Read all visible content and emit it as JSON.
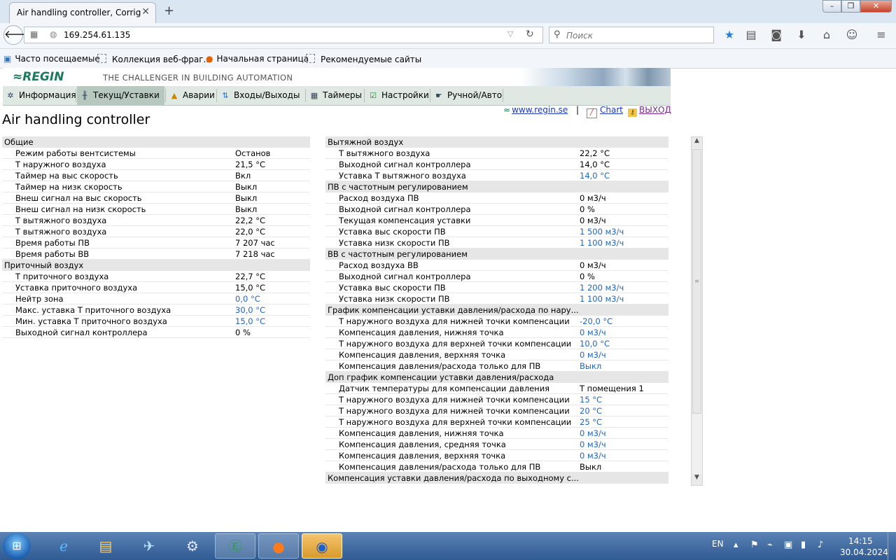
{
  "browser": {
    "tab_title": "Air handling controller, Corrigo E",
    "tab_close": "✕",
    "new_tab": "+",
    "url": "169.254.61.135",
    "search_placeholder": "Поиск",
    "bookmarks": [
      "Часто посещаемые",
      "Коллекция веб-фраг...",
      "Начальная страница",
      "Рекомендуемые сайты"
    ]
  },
  "app": {
    "logo": "≈REGIN",
    "tagline": "THE CHALLENGER IN BUILDING AUTOMATION",
    "menu": [
      "Информация",
      "Текущ/Уставки",
      "Аварии",
      "Входы/Выходы",
      "Таймеры",
      "Настройки",
      "Ручной/Авто"
    ],
    "active_menu": "Текущ/Уставки",
    "page_title": "Air handling controller",
    "links": {
      "site": "www.regin.se",
      "sep": "|",
      "chart": "Chart",
      "exit": "ВЫХОД"
    }
  },
  "left": [
    {
      "title": "Общие",
      "rows": [
        {
          "label": "Режим работы вентсистемы",
          "value": "Останов",
          "editable": false
        },
        {
          "label": "Т наружного воздуха",
          "value": "21,5 °C",
          "editable": false
        },
        {
          "label": "Таймер на выс скорость",
          "value": "Вкл",
          "editable": false
        },
        {
          "label": "Таймер на низк скорость",
          "value": "Выкл",
          "editable": false
        },
        {
          "label": "Внеш сигнал на выс скорость",
          "value": "Выкл",
          "editable": false
        },
        {
          "label": "Внеш сигнал на низк скорость",
          "value": "Выкл",
          "editable": false
        },
        {
          "label": "Т вытяжного воздуха",
          "value": "22,2 °C",
          "editable": false
        },
        {
          "label": "Т вытяжного воздуха",
          "value": "22,0 °C",
          "editable": false
        },
        {
          "label": "Время работы ПВ",
          "value": "7 207 час",
          "editable": false
        },
        {
          "label": "Время работы ВВ",
          "value": "7 218 час",
          "editable": false
        }
      ]
    },
    {
      "title": "Приточный воздух",
      "rows": [
        {
          "label": "Т приточного воздуха",
          "value": "22,7 °C",
          "editable": false
        },
        {
          "label": "Уставка приточного воздуха",
          "value": "15,0 °C",
          "editable": false
        },
        {
          "label": "Нейтр зона",
          "value": "0,0 °C",
          "editable": true
        },
        {
          "label": "Макс. уставка Т приточного воздуха",
          "value": "30,0 °C",
          "editable": true
        },
        {
          "label": "Мин. уставка Т приточного воздуха",
          "value": "15,0 °C",
          "editable": true
        },
        {
          "label": "Выходной сигнал контроллера",
          "value": "0 %",
          "editable": false
        }
      ]
    }
  ],
  "right": [
    {
      "title": "Вытяжной воздух",
      "rows": [
        {
          "label": "Т вытяжного воздуха",
          "value": "22,2 °C",
          "editable": false
        },
        {
          "label": "Выходной сигнал контроллера",
          "value": "14,0 °C",
          "editable": false
        },
        {
          "label": "Уставка Т вытяжного воздуха",
          "value": "14,0 °C",
          "editable": true
        }
      ]
    },
    {
      "title": "ПВ с частотным регулированием",
      "rows": [
        {
          "label": "Расход воздуха ПВ",
          "value": "0 м3/ч",
          "editable": false
        },
        {
          "label": "Выходной сигнал контроллера",
          "value": "0 %",
          "editable": false
        },
        {
          "label": "Текущая компенсация уставки",
          "value": "0 м3/ч",
          "editable": false
        },
        {
          "label": "Уставка выс скорости ПВ",
          "value": "1 500 м3/ч",
          "editable": true
        },
        {
          "label": "Уставка низк скорости ПВ",
          "value": "1 100 м3/ч",
          "editable": true
        }
      ]
    },
    {
      "title": "ВВ с частотным регулированием",
      "rows": [
        {
          "label": "Расход воздуха ВВ",
          "value": "0 м3/ч",
          "editable": false
        },
        {
          "label": "Выходной сигнал контроллера",
          "value": "0 %",
          "editable": false
        },
        {
          "label": "Уставка выс скорости ПВ",
          "value": "1 200 м3/ч",
          "editable": true
        },
        {
          "label": "Уставка низк скорости ПВ",
          "value": "1 100 м3/ч",
          "editable": true
        }
      ]
    },
    {
      "title": "График компенсации уставки давления/расхода по нару...",
      "rows": [
        {
          "label": "Т наружного воздуха для нижней точки компенсации",
          "value": "-20,0 °C",
          "editable": true
        },
        {
          "label": "Компенсация давления, нижняя точка",
          "value": "0 м3/ч",
          "editable": true
        },
        {
          "label": "Т наружного воздуха для верхней точки компенсации",
          "value": "10,0 °C",
          "editable": true
        },
        {
          "label": "Компенсация давления, верхняя точка",
          "value": "0 м3/ч",
          "editable": true
        },
        {
          "label": "Компенсация давления/расхода только для ПВ",
          "value": "Выкл",
          "editable": true
        }
      ]
    },
    {
      "title": "Доп график компенсации уставки давления/расхода",
      "rows": [
        {
          "label": "Датчик температуры для компенсации давления",
          "value": "Т помещения 1",
          "editable": false
        },
        {
          "label": "Т наружного воздуха для нижней точки компенсации",
          "value": "15 °C",
          "editable": true
        },
        {
          "label": "Т наружного воздуха для нижней точки компенсации",
          "value": "20 °C",
          "editable": true
        },
        {
          "label": "Т наружного воздуха для верхней точки компенсации",
          "value": "25 °C",
          "editable": true
        },
        {
          "label": "Компенсация давления, нижняя точка",
          "value": "0 м3/ч",
          "editable": true
        },
        {
          "label": "Компенсация давления, средняя точка",
          "value": "0 м3/ч",
          "editable": true
        },
        {
          "label": "Компенсация давления, верхняя точка",
          "value": "0 м3/ч",
          "editable": true
        },
        {
          "label": "Компенсация давления/расхода только для ПВ",
          "value": "Выкл",
          "editable": false
        }
      ]
    },
    {
      "title": "Компенсация уставки давления/расхода по выходному с...",
      "rows": []
    }
  ],
  "taskbar": {
    "lang": "EN",
    "time": "14:15",
    "date": "30.04.2024"
  },
  "colors": {
    "editable_value": "#1f64c2",
    "menu_bg": "#dfe8e3",
    "section_bg": "#e6e6e6",
    "link": "#1d39b8"
  }
}
